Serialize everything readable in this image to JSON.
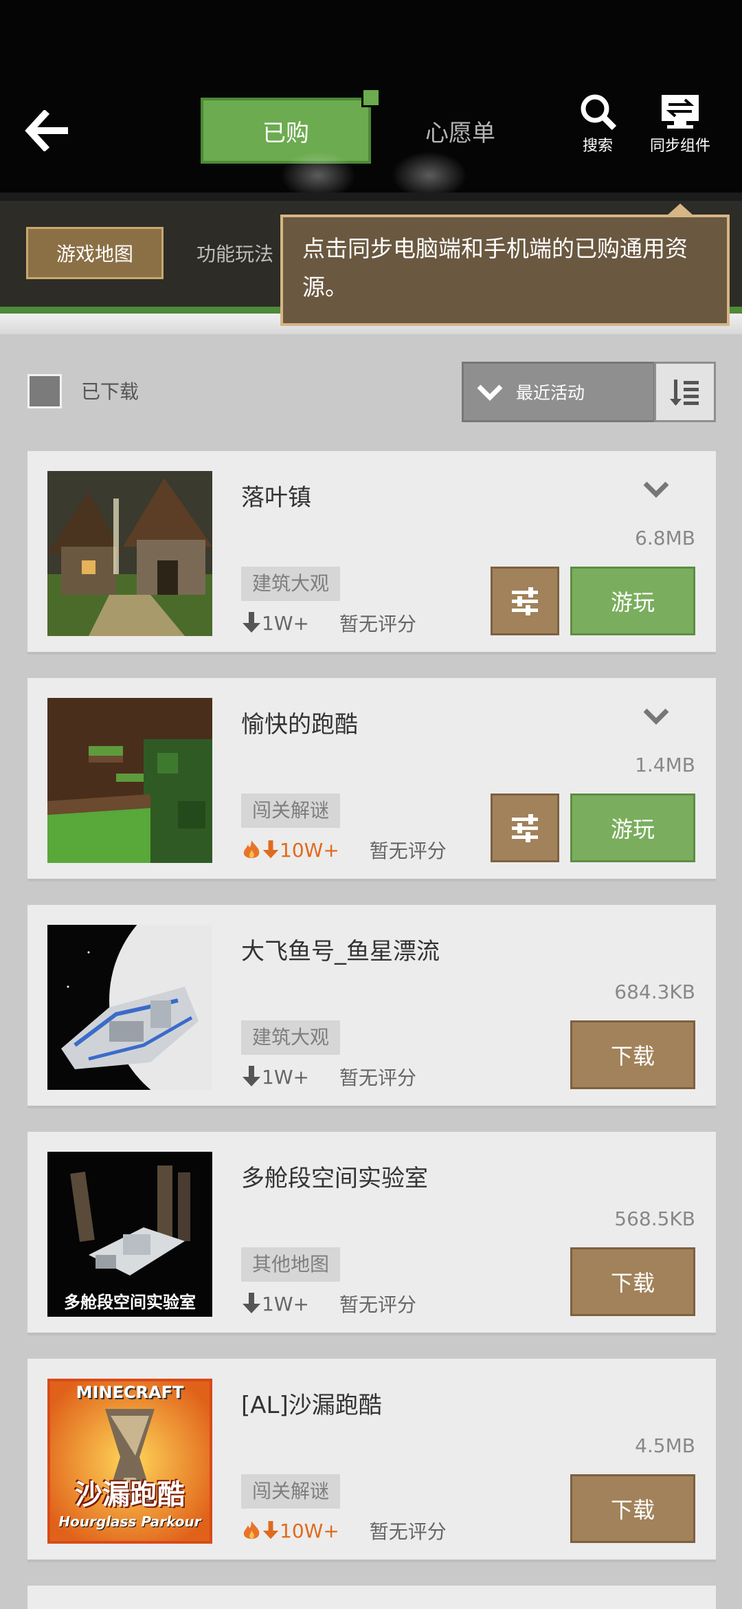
{
  "header": {
    "tabs": {
      "purchased": "已购",
      "wishlist": "心愿单"
    },
    "search_label": "搜索",
    "sync_label": "同步组件"
  },
  "categories": {
    "active": "游戏地图",
    "other": "功能玩法"
  },
  "tooltip": {
    "text": "点击同步电脑端和手机端的已购通用资源。"
  },
  "filter": {
    "downloaded_label": "已下载",
    "sort_label": "最近活动"
  },
  "items": [
    {
      "title": "落叶镇",
      "size": "6.8MB",
      "tag": "建筑大观",
      "downloads": "1W+",
      "hot": false,
      "rating": "暂无评分",
      "action": "游玩",
      "settings": true
    },
    {
      "title": "愉快的跑酷",
      "size": "1.4MB",
      "tag": "闯关解谜",
      "downloads": "10W+",
      "hot": true,
      "rating": "暂无评分",
      "action": "游玩",
      "settings": true
    },
    {
      "title": "大飞鱼号_鱼星漂流",
      "size": "684.3KB",
      "tag": "建筑大观",
      "downloads": "1W+",
      "hot": false,
      "rating": "暂无评分",
      "action": "下载",
      "settings": false
    },
    {
      "title": "多舱段空间实验室",
      "size": "568.5KB",
      "tag": "其他地图",
      "downloads": "1W+",
      "hot": false,
      "rating": "暂无评分",
      "action": "下载",
      "settings": false,
      "thumb_caption": "多舱段空间实验室"
    },
    {
      "title": "[AL]沙漏跑酷",
      "size": "4.5MB",
      "tag": "闯关解谜",
      "downloads": "10W+",
      "hot": true,
      "rating": "暂无评分",
      "action": "下载",
      "settings": false,
      "thumb_brand": "MINECRAFT",
      "thumb_title_cn": "沙漏跑酷",
      "thumb_title_en": "Hourglass Parkour"
    }
  ],
  "colors": {
    "accent_green": "#6cab4f",
    "brown_button": "#a2825a",
    "hot_orange": "#e06a1d"
  }
}
